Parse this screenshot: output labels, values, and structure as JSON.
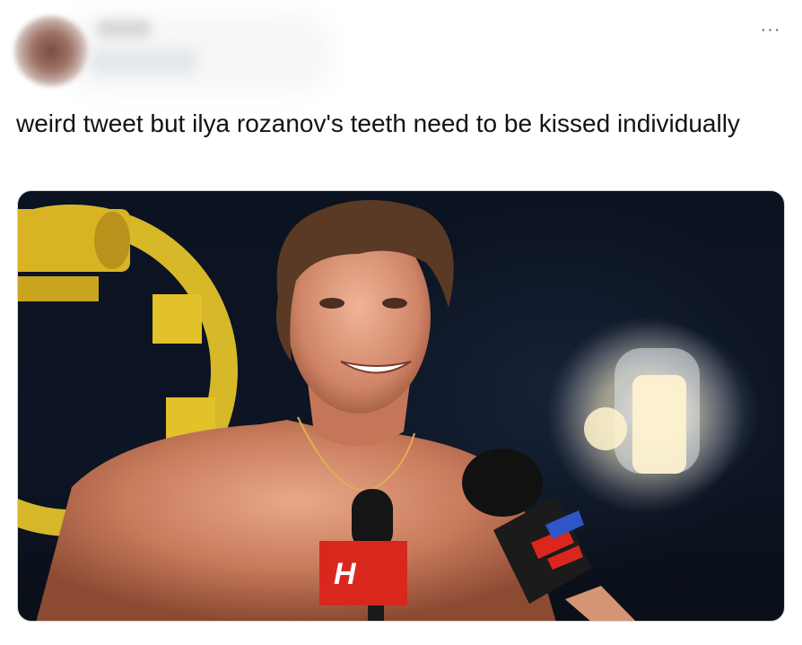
{
  "tweet": {
    "more_label": "···",
    "text": "weird tweet but ilya rozanov's teeth need to be kissed individually"
  },
  "media": {
    "mic_flag_left": "H"
  },
  "colors": {
    "text": "#0f1419",
    "muted": "#536471",
    "logo_yellow": "#e2c12a",
    "mic_red": "#d9271d",
    "mic_blue": "#2f56c9"
  }
}
